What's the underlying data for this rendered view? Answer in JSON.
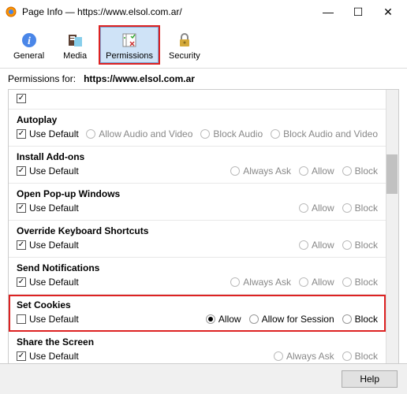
{
  "window": {
    "title": "Page Info — https://www.elsol.com.ar/",
    "minimize_glyph": "—",
    "maximize_glyph": "☐",
    "close_glyph": "✕"
  },
  "toolbar": {
    "general": "General",
    "media": "Media",
    "permissions": "Permissions",
    "security": "Security"
  },
  "permissions_for_label": "Permissions for:",
  "permissions_for_url": "https://www.elsol.com.ar",
  "use_default_label": "Use Default",
  "sections": {
    "autoplay": {
      "title": "Autoplay",
      "opt1": "Allow Audio and Video",
      "opt2": "Block Audio",
      "opt3": "Block Audio and Video"
    },
    "install_addons": {
      "title": "Install Add-ons",
      "opt1": "Always Ask",
      "opt2": "Allow",
      "opt3": "Block"
    },
    "popup": {
      "title": "Open Pop-up Windows",
      "opt1": "Allow",
      "opt2": "Block"
    },
    "override_shortcuts": {
      "title": "Override Keyboard Shortcuts",
      "opt1": "Allow",
      "opt2": "Block"
    },
    "send_notifications": {
      "title": "Send Notifications",
      "opt1": "Always Ask",
      "opt2": "Allow",
      "opt3": "Block"
    },
    "set_cookies": {
      "title": "Set Cookies",
      "opt1": "Allow",
      "opt2": "Allow for Session",
      "opt3": "Block"
    },
    "share_screen": {
      "title": "Share the Screen",
      "opt1": "Always Ask",
      "opt2": "Block"
    }
  },
  "help_label": "Help"
}
